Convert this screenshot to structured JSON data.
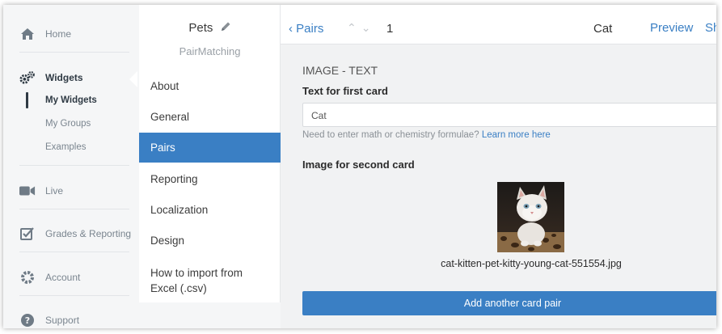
{
  "nav": {
    "home": "Home",
    "widgets": "Widgets",
    "my_widgets": "My Widgets",
    "my_groups": "My Groups",
    "examples": "Examples",
    "live": "Live",
    "grades": "Grades & Reporting",
    "account": "Account",
    "support": "Support"
  },
  "widget": {
    "title": "Pets",
    "subtitle": "PairMatching",
    "menu": [
      "About",
      "General",
      "Pairs",
      "Reporting",
      "Localization",
      "Design",
      "How to import from",
      "Excel (.csv)"
    ]
  },
  "topbar": {
    "back_label": "Pairs",
    "pair_number": "1",
    "pair_name": "Cat",
    "preview_label": "Preview",
    "share_label": "Sh"
  },
  "editor": {
    "section_title": "IMAGE - TEXT",
    "first_card_label": "Text for first card",
    "first_card_value": "Cat",
    "hint_text": "Need to enter math or chemistry formulae?",
    "hint_link": "Learn more here",
    "second_card_label": "Image for second card",
    "image_filename": "cat-kitten-pet-kitty-young-cat-551554.jpg",
    "add_button": "Add another card pair"
  },
  "colors": {
    "accent": "#3a7fc4",
    "nav_bg": "#f5f6f7",
    "main_bg": "#f1f2f3"
  }
}
